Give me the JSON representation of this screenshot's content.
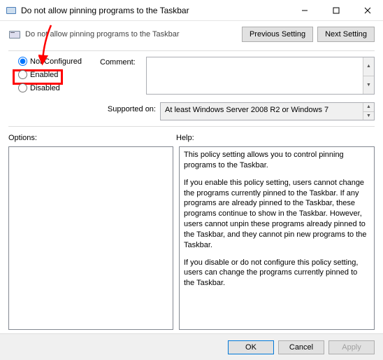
{
  "window": {
    "title": "Do not allow pinning programs to the Taskbar"
  },
  "header": {
    "title": "Do not allow pinning programs to the Taskbar",
    "prev_btn": "Previous Setting",
    "next_btn": "Next Setting"
  },
  "radios": {
    "not_configured": "Not Configured",
    "enabled": "Enabled",
    "disabled": "Disabled"
  },
  "comment": {
    "label": "Comment:",
    "value": ""
  },
  "supported": {
    "label": "Supported on:",
    "value": "At least Windows Server 2008 R2 or Windows 7"
  },
  "labels": {
    "options": "Options:",
    "help": "Help:"
  },
  "help": {
    "p1": "This policy setting allows you to control pinning programs to the Taskbar.",
    "p2": "If you enable this policy setting, users cannot change the programs currently pinned to the Taskbar. If any programs are already pinned to the Taskbar, these programs continue to show in the Taskbar. However, users cannot unpin these programs already pinned to the Taskbar, and they cannot pin new programs to the Taskbar.",
    "p3": "If you disable or do not configure this policy setting, users can change the programs currently pinned to the Taskbar."
  },
  "footer": {
    "ok": "OK",
    "cancel": "Cancel",
    "apply": "Apply"
  }
}
